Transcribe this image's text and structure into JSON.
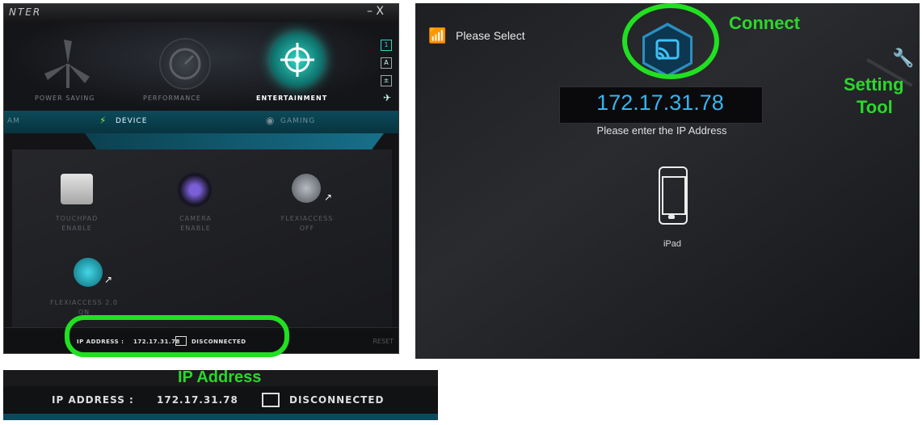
{
  "left_panel": {
    "app_title": "NTER",
    "window_controls": "– X",
    "modes": [
      {
        "label": "POWER SAVING"
      },
      {
        "label": "PERFORMANCE"
      },
      {
        "label": "ENTERTAINMENT",
        "active": true
      }
    ],
    "side_buttons": [
      "1",
      "A",
      "±",
      "✈"
    ],
    "tabs": [
      {
        "label": "AM"
      },
      {
        "label": "DEVICE",
        "active": true
      },
      {
        "label": "GAMING"
      }
    ],
    "devices": [
      {
        "name": "TOUCHPAD",
        "state": "ENABLE"
      },
      {
        "name": "CAMERA",
        "state": "ENABLE"
      },
      {
        "name": "FLEXIACCESS",
        "state": "OFF"
      },
      {
        "name": "FLEXIACCESS 2.0",
        "state": "ON"
      }
    ],
    "status_bar": {
      "ip_label": "IP ADDRESS :",
      "ip_value": "172.17.31.78",
      "status": "DISCONNECTED",
      "reset": "RESET"
    }
  },
  "right_panel": {
    "please_select": "Please Select",
    "ip_value": "172.17.31.78",
    "prompt": "Please enter the IP Address",
    "device_label": "iPad"
  },
  "annotations": {
    "connect": "Connect",
    "setting_tool_line1": "Setting",
    "setting_tool_line2": "Tool",
    "ip_address": "IP Address"
  },
  "bottom_panel": {
    "ip_label": "IP ADDRESS :",
    "ip_value": "172.17.31.78",
    "status": "DISCONNECTED"
  },
  "colors": {
    "accent_blue": "#37b4f0",
    "annotation_green": "#21e021",
    "tab_teal": "#0b4a5c"
  }
}
